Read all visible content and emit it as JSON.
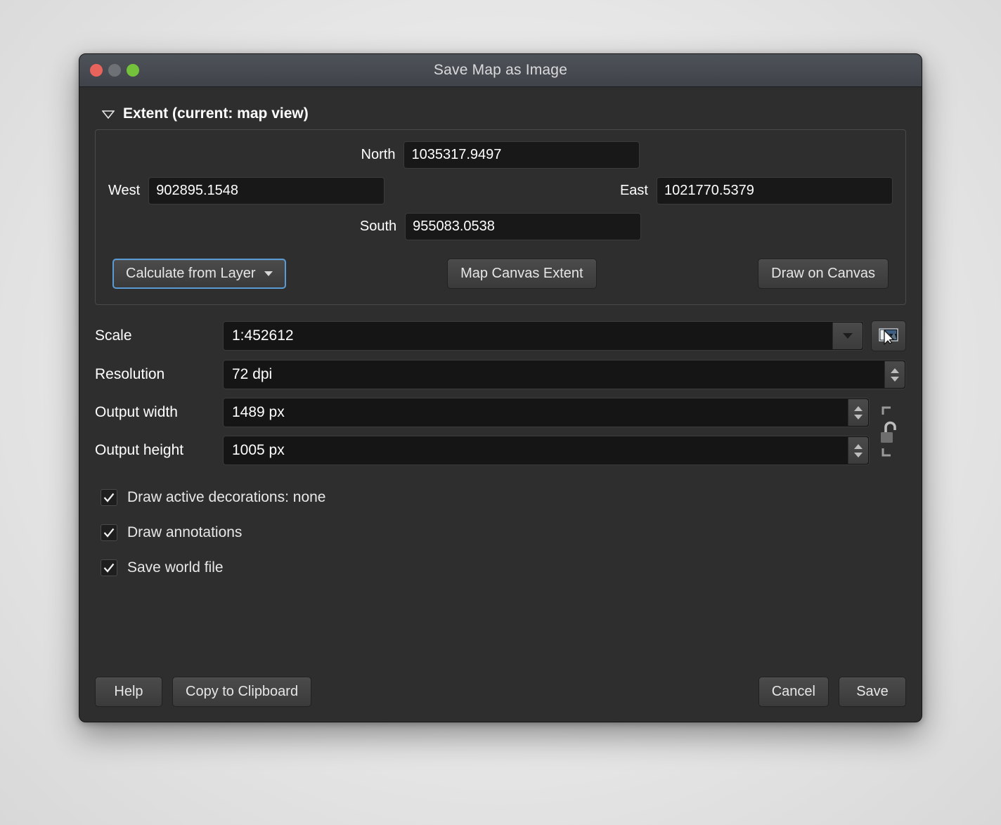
{
  "window": {
    "title": "Save Map as Image",
    "traffic_lights": {
      "close": "close-button",
      "minimize": "minimize-button",
      "zoom": "zoom-button"
    }
  },
  "extent": {
    "section_title": "Extent (current: map view)",
    "collapse_state": "expanded",
    "fields": {
      "north_label": "North",
      "north_value": "1035317.9497",
      "west_label": "West",
      "west_value": "902895.1548",
      "east_label": "East",
      "east_value": "1021770.5379",
      "south_label": "South",
      "south_value": "955083.0538"
    },
    "buttons": {
      "calculate_from_layer": "Calculate from Layer",
      "map_canvas_extent": "Map Canvas Extent",
      "draw_on_canvas": "Draw on Canvas"
    }
  },
  "settings": {
    "scale_label": "Scale",
    "scale_value": "1:452612",
    "scale_canvas_button_icon": "map-canvas-scale-icon",
    "resolution_label": "Resolution",
    "resolution_value": "72 dpi",
    "output_width_label": "Output width",
    "output_width_value": "1489 px",
    "output_height_label": "Output height",
    "output_height_value": "1005 px",
    "lock_aspect_icon": "unlocked-padlock-icon",
    "lock_aspect_state": "unlocked"
  },
  "options": [
    {
      "label": "Draw active decorations: none",
      "checked": true,
      "name": "draw-active-decorations"
    },
    {
      "label": "Draw annotations",
      "checked": true,
      "name": "draw-annotations"
    },
    {
      "label": "Save world file",
      "checked": true,
      "name": "save-world-file"
    }
  ],
  "footer": {
    "help": "Help",
    "copy_to_clipboard": "Copy to Clipboard",
    "cancel": "Cancel",
    "save": "Save"
  },
  "colors": {
    "window_bg": "#2e2e2e",
    "titlebar": "#474b51",
    "input_bg": "#151515",
    "accent_focus": "#5a9bd5",
    "close_light": "#e8635c",
    "min_light": "#6e7277",
    "zoom_light": "#74c23c"
  }
}
